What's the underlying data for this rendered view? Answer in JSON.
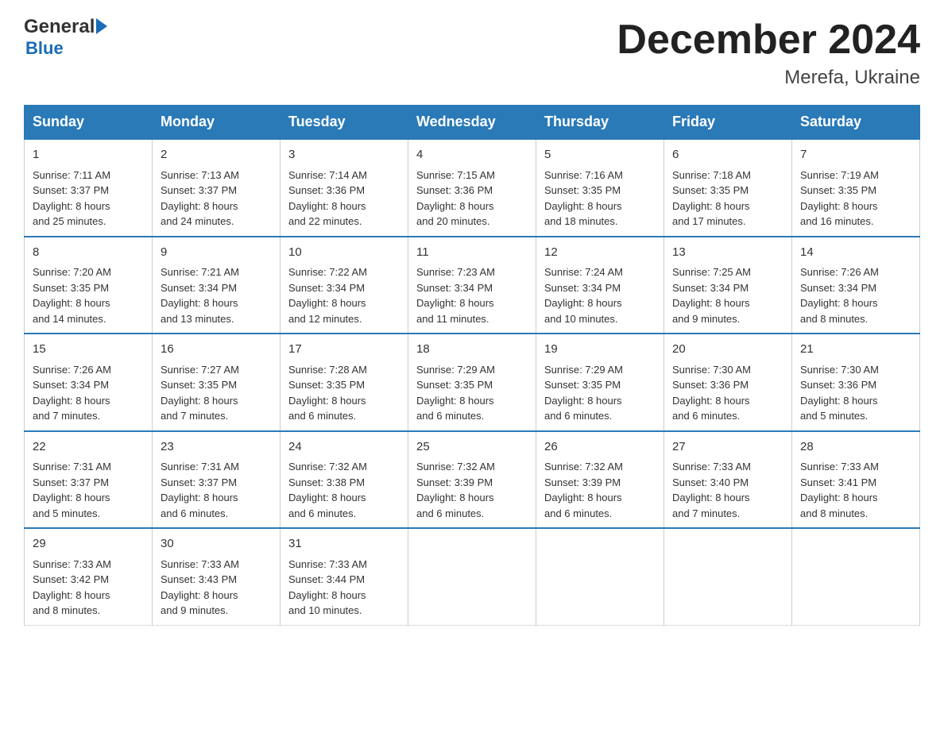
{
  "logo": {
    "general": "General",
    "blue": "Blue",
    "triangle": "▶"
  },
  "title": "December 2024",
  "location": "Merefa, Ukraine",
  "days_of_week": [
    "Sunday",
    "Monday",
    "Tuesday",
    "Wednesday",
    "Thursday",
    "Friday",
    "Saturday"
  ],
  "weeks": [
    [
      {
        "day": "1",
        "info": "Sunrise: 7:11 AM\nSunset: 3:37 PM\nDaylight: 8 hours\nand 25 minutes."
      },
      {
        "day": "2",
        "info": "Sunrise: 7:13 AM\nSunset: 3:37 PM\nDaylight: 8 hours\nand 24 minutes."
      },
      {
        "day": "3",
        "info": "Sunrise: 7:14 AM\nSunset: 3:36 PM\nDaylight: 8 hours\nand 22 minutes."
      },
      {
        "day": "4",
        "info": "Sunrise: 7:15 AM\nSunset: 3:36 PM\nDaylight: 8 hours\nand 20 minutes."
      },
      {
        "day": "5",
        "info": "Sunrise: 7:16 AM\nSunset: 3:35 PM\nDaylight: 8 hours\nand 18 minutes."
      },
      {
        "day": "6",
        "info": "Sunrise: 7:18 AM\nSunset: 3:35 PM\nDaylight: 8 hours\nand 17 minutes."
      },
      {
        "day": "7",
        "info": "Sunrise: 7:19 AM\nSunset: 3:35 PM\nDaylight: 8 hours\nand 16 minutes."
      }
    ],
    [
      {
        "day": "8",
        "info": "Sunrise: 7:20 AM\nSunset: 3:35 PM\nDaylight: 8 hours\nand 14 minutes."
      },
      {
        "day": "9",
        "info": "Sunrise: 7:21 AM\nSunset: 3:34 PM\nDaylight: 8 hours\nand 13 minutes."
      },
      {
        "day": "10",
        "info": "Sunrise: 7:22 AM\nSunset: 3:34 PM\nDaylight: 8 hours\nand 12 minutes."
      },
      {
        "day": "11",
        "info": "Sunrise: 7:23 AM\nSunset: 3:34 PM\nDaylight: 8 hours\nand 11 minutes."
      },
      {
        "day": "12",
        "info": "Sunrise: 7:24 AM\nSunset: 3:34 PM\nDaylight: 8 hours\nand 10 minutes."
      },
      {
        "day": "13",
        "info": "Sunrise: 7:25 AM\nSunset: 3:34 PM\nDaylight: 8 hours\nand 9 minutes."
      },
      {
        "day": "14",
        "info": "Sunrise: 7:26 AM\nSunset: 3:34 PM\nDaylight: 8 hours\nand 8 minutes."
      }
    ],
    [
      {
        "day": "15",
        "info": "Sunrise: 7:26 AM\nSunset: 3:34 PM\nDaylight: 8 hours\nand 7 minutes."
      },
      {
        "day": "16",
        "info": "Sunrise: 7:27 AM\nSunset: 3:35 PM\nDaylight: 8 hours\nand 7 minutes."
      },
      {
        "day": "17",
        "info": "Sunrise: 7:28 AM\nSunset: 3:35 PM\nDaylight: 8 hours\nand 6 minutes."
      },
      {
        "day": "18",
        "info": "Sunrise: 7:29 AM\nSunset: 3:35 PM\nDaylight: 8 hours\nand 6 minutes."
      },
      {
        "day": "19",
        "info": "Sunrise: 7:29 AM\nSunset: 3:35 PM\nDaylight: 8 hours\nand 6 minutes."
      },
      {
        "day": "20",
        "info": "Sunrise: 7:30 AM\nSunset: 3:36 PM\nDaylight: 8 hours\nand 6 minutes."
      },
      {
        "day": "21",
        "info": "Sunrise: 7:30 AM\nSunset: 3:36 PM\nDaylight: 8 hours\nand 5 minutes."
      }
    ],
    [
      {
        "day": "22",
        "info": "Sunrise: 7:31 AM\nSunset: 3:37 PM\nDaylight: 8 hours\nand 5 minutes."
      },
      {
        "day": "23",
        "info": "Sunrise: 7:31 AM\nSunset: 3:37 PM\nDaylight: 8 hours\nand 6 minutes."
      },
      {
        "day": "24",
        "info": "Sunrise: 7:32 AM\nSunset: 3:38 PM\nDaylight: 8 hours\nand 6 minutes."
      },
      {
        "day": "25",
        "info": "Sunrise: 7:32 AM\nSunset: 3:39 PM\nDaylight: 8 hours\nand 6 minutes."
      },
      {
        "day": "26",
        "info": "Sunrise: 7:32 AM\nSunset: 3:39 PM\nDaylight: 8 hours\nand 6 minutes."
      },
      {
        "day": "27",
        "info": "Sunrise: 7:33 AM\nSunset: 3:40 PM\nDaylight: 8 hours\nand 7 minutes."
      },
      {
        "day": "28",
        "info": "Sunrise: 7:33 AM\nSunset: 3:41 PM\nDaylight: 8 hours\nand 8 minutes."
      }
    ],
    [
      {
        "day": "29",
        "info": "Sunrise: 7:33 AM\nSunset: 3:42 PM\nDaylight: 8 hours\nand 8 minutes."
      },
      {
        "day": "30",
        "info": "Sunrise: 7:33 AM\nSunset: 3:43 PM\nDaylight: 8 hours\nand 9 minutes."
      },
      {
        "day": "31",
        "info": "Sunrise: 7:33 AM\nSunset: 3:44 PM\nDaylight: 8 hours\nand 10 minutes."
      },
      {
        "day": "",
        "info": ""
      },
      {
        "day": "",
        "info": ""
      },
      {
        "day": "",
        "info": ""
      },
      {
        "day": "",
        "info": ""
      }
    ]
  ]
}
